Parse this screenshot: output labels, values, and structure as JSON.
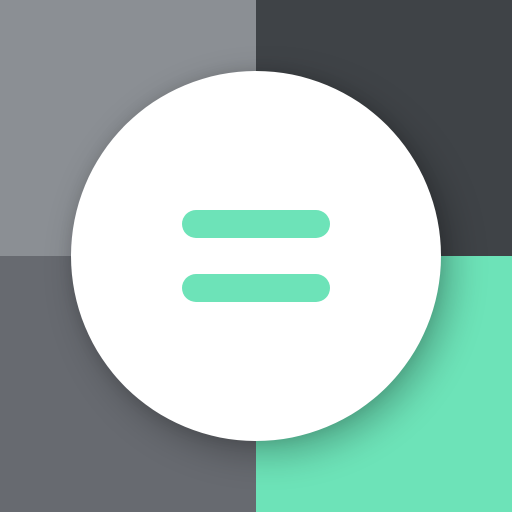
{
  "icon": {
    "name": "equals-icon",
    "colors": {
      "top_left": "#8b8f94",
      "top_right": "#3f4347",
      "bottom_left": "#676a70",
      "bottom_right": "#6de3b8",
      "circle": "#ffffff",
      "bars": "#6de3b8"
    }
  }
}
